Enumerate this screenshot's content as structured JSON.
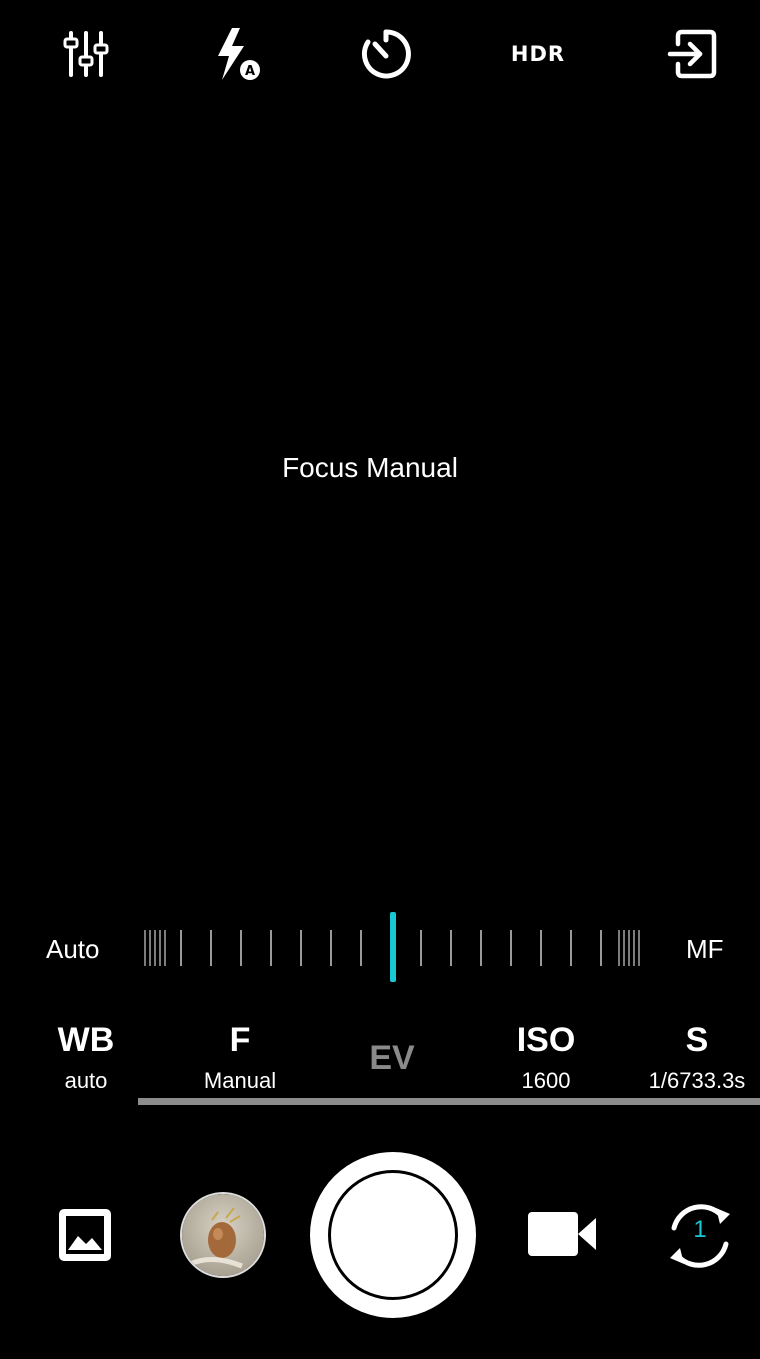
{
  "top_bar": {
    "hdr_label": "HDR",
    "icons": [
      "sliders-icon",
      "flash-auto-icon",
      "timer-icon",
      "hdr-icon",
      "exit-icon"
    ]
  },
  "viewfinder": {
    "focus_text": "Focus Manual"
  },
  "focus_slider": {
    "left_label": "Auto",
    "right_label": "MF",
    "position": 0.5,
    "accent_color": "#18c8d2"
  },
  "params": {
    "wb": {
      "name": "WB",
      "value": "auto"
    },
    "f": {
      "name": "F",
      "value": "Manual"
    },
    "ev": {
      "name": "EV",
      "value": ""
    },
    "iso": {
      "name": "ISO",
      "value": "1600"
    },
    "s": {
      "name": "S",
      "value": "1/6733.3s"
    }
  },
  "bottom": {
    "switch_camera_number": "1",
    "icons": [
      "gallery-icon",
      "last-photo-thumbnail",
      "shutter-button",
      "video-icon",
      "switch-camera-icon"
    ]
  }
}
